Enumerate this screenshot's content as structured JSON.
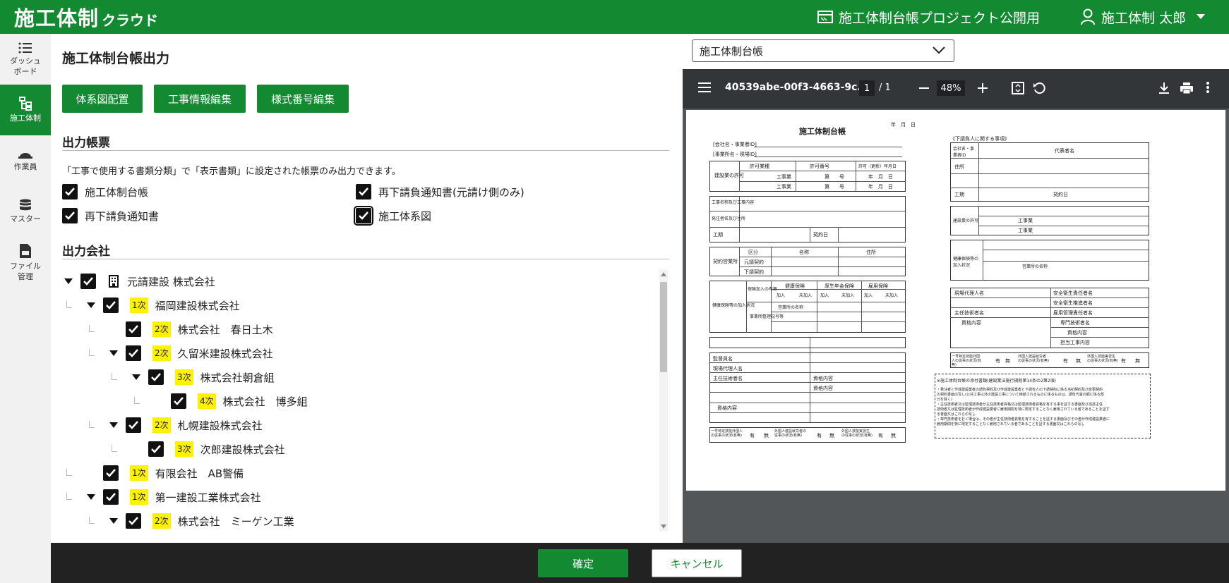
{
  "header": {
    "logo_main": "施工体制",
    "logo_sub": "クラウド",
    "project_name": "施工体制台帳プロジェクト公開用",
    "user_name": "施工体制 太郎"
  },
  "sidebar": {
    "items": [
      {
        "label": "ダッシュ\nボード"
      },
      {
        "label": "施工体制"
      },
      {
        "label": "作業員"
      },
      {
        "label": "マスター"
      },
      {
        "label": "ファイル\n管理"
      }
    ]
  },
  "page": {
    "title": "施工体制台帳出力",
    "buttons": [
      "体系図配置",
      "工事情報編集",
      "様式番号編集"
    ],
    "output_forms_title": "出力帳票",
    "output_forms_note": "「工事で使用する書類分類」で「表示書類」に設定された帳票のみ出力できます。",
    "forms": [
      {
        "label": "施工体制台帳",
        "checked": true
      },
      {
        "label": "再下請負通知書(元請け側のみ)",
        "checked": true
      },
      {
        "label": "再下請負通知書",
        "checked": true
      },
      {
        "label": "施工体系図",
        "checked": true
      }
    ],
    "output_company_title": "出力会社",
    "tree": [
      {
        "name": "元請建設 株式会社",
        "level": "",
        "checked": true,
        "expanded": true
      },
      {
        "name": "福岡建設株式会社",
        "level": "1次",
        "checked": true,
        "expanded": true
      },
      {
        "name": "株式会社　春日土木",
        "level": "2次",
        "checked": true
      },
      {
        "name": "久留米建設株式会社",
        "level": "2次",
        "checked": true,
        "expanded": true
      },
      {
        "name": "株式会社朝倉組",
        "level": "3次",
        "checked": true,
        "expanded": true
      },
      {
        "name": "株式会社　博多組",
        "level": "4次",
        "checked": true
      },
      {
        "name": "札幌建設株式会社",
        "level": "2次",
        "checked": true,
        "expanded": true
      },
      {
        "name": "次郎建設株式会社",
        "level": "3次",
        "checked": true
      },
      {
        "name": "有限会社　AB警備",
        "level": "1次",
        "checked": true
      },
      {
        "name": "第一建設工業株式会社",
        "level": "1次",
        "checked": true,
        "expanded": true
      },
      {
        "name": "株式会社　ミーゲン工業",
        "level": "2次",
        "checked": true,
        "expanded": true
      }
    ]
  },
  "preview": {
    "select_value": "施工体制台帳",
    "file_name": "40539abe-00f3-4663-9c...",
    "page_current": "1",
    "page_total": "/ 1",
    "zoom": "48%",
    "doc": {
      "title": "施工体制台帳",
      "date": "年　月　日",
      "right_header": "《下請負人に関する事項》",
      "left_fields": [
        "[会社名・事業者ID]",
        "[事業所名・現場ID]"
      ],
      "permit": "建設業の許可",
      "permit_cols": [
        "許可業種",
        "許可番号",
        "許可（更新）年月日"
      ],
      "construction": "工事業",
      "num": "第　　号",
      "project_name": "工事名称及び工事内容",
      "orderer": "発注者名及び住所",
      "period": "工期",
      "contract_date": "契約日",
      "contract": "契約営業所",
      "contract_cols": [
        "区分",
        "名称",
        "住所"
      ],
      "contract_rows": [
        "元請契約",
        "下請契約"
      ],
      "insurance": "健康保険等の加入状況",
      "insurance_cols": [
        "保険加入の有無",
        "健康保険",
        "厚生年金保険",
        "雇用保険"
      ],
      "join": "加入",
      "nojoin": "未加入",
      "exempt": "適用除外",
      "office_no": "事業所整理記号等",
      "office_name": "営業所の名称",
      "supervisor": "監督員名",
      "field_agent": "現場代理人名",
      "chief_engineer": "主任技術者名",
      "qualification": "資格内容",
      "foreign": "一号特定技能外国人の従事の状況(有無)",
      "foreign2": "外国人建設就労者の従事の状況(有無)",
      "foreign3": "外国人技能実習生の従事の状況(有無)",
      "yes": "有",
      "no": "無",
      "right_company": "会社名・事業者ID",
      "rep": "代表者名",
      "address": "住所",
      "safety": [
        "安全衛生責任者名",
        "安全衛生推進者名",
        "雇用管理責任者名",
        "専門技術者名",
        "資格内容",
        "担当工事内容"
      ],
      "attachment_title": "※施工体制台帳の添付書類(建設業法施行規則第14条の2第2項)",
      "attachment_lines": [
        "・発注者と作成建設業者の請負契約及び作成建設業者と下請負人の下請契約に係る当初契約及び変更契約",
        "の契約書面の写し(公共工事以外の建設工事について締結されるものに係るものは、請負代金の額に係る部",
        "分を除く)",
        "・主任技術者又は監理技術者が主任技術者資格又は監理技術者資格を有する事を証する書面及び当該主任",
        "技術者又は監理技術者が作成建設業者に雇用期間を特に限定することなく雇用されている者であることを証す",
        "る書面又はこれらの写し",
        "・専門技術者をおく場合は、その者が主任技術者資格を有することを証する書面及びその者が作成建設業者に",
        "雇用期間を特に限定することなく雇用されている者であることを証する書面又はこれらの写し"
      ]
    }
  },
  "footer": {
    "ok": "確定",
    "cancel": "キャンセル"
  }
}
